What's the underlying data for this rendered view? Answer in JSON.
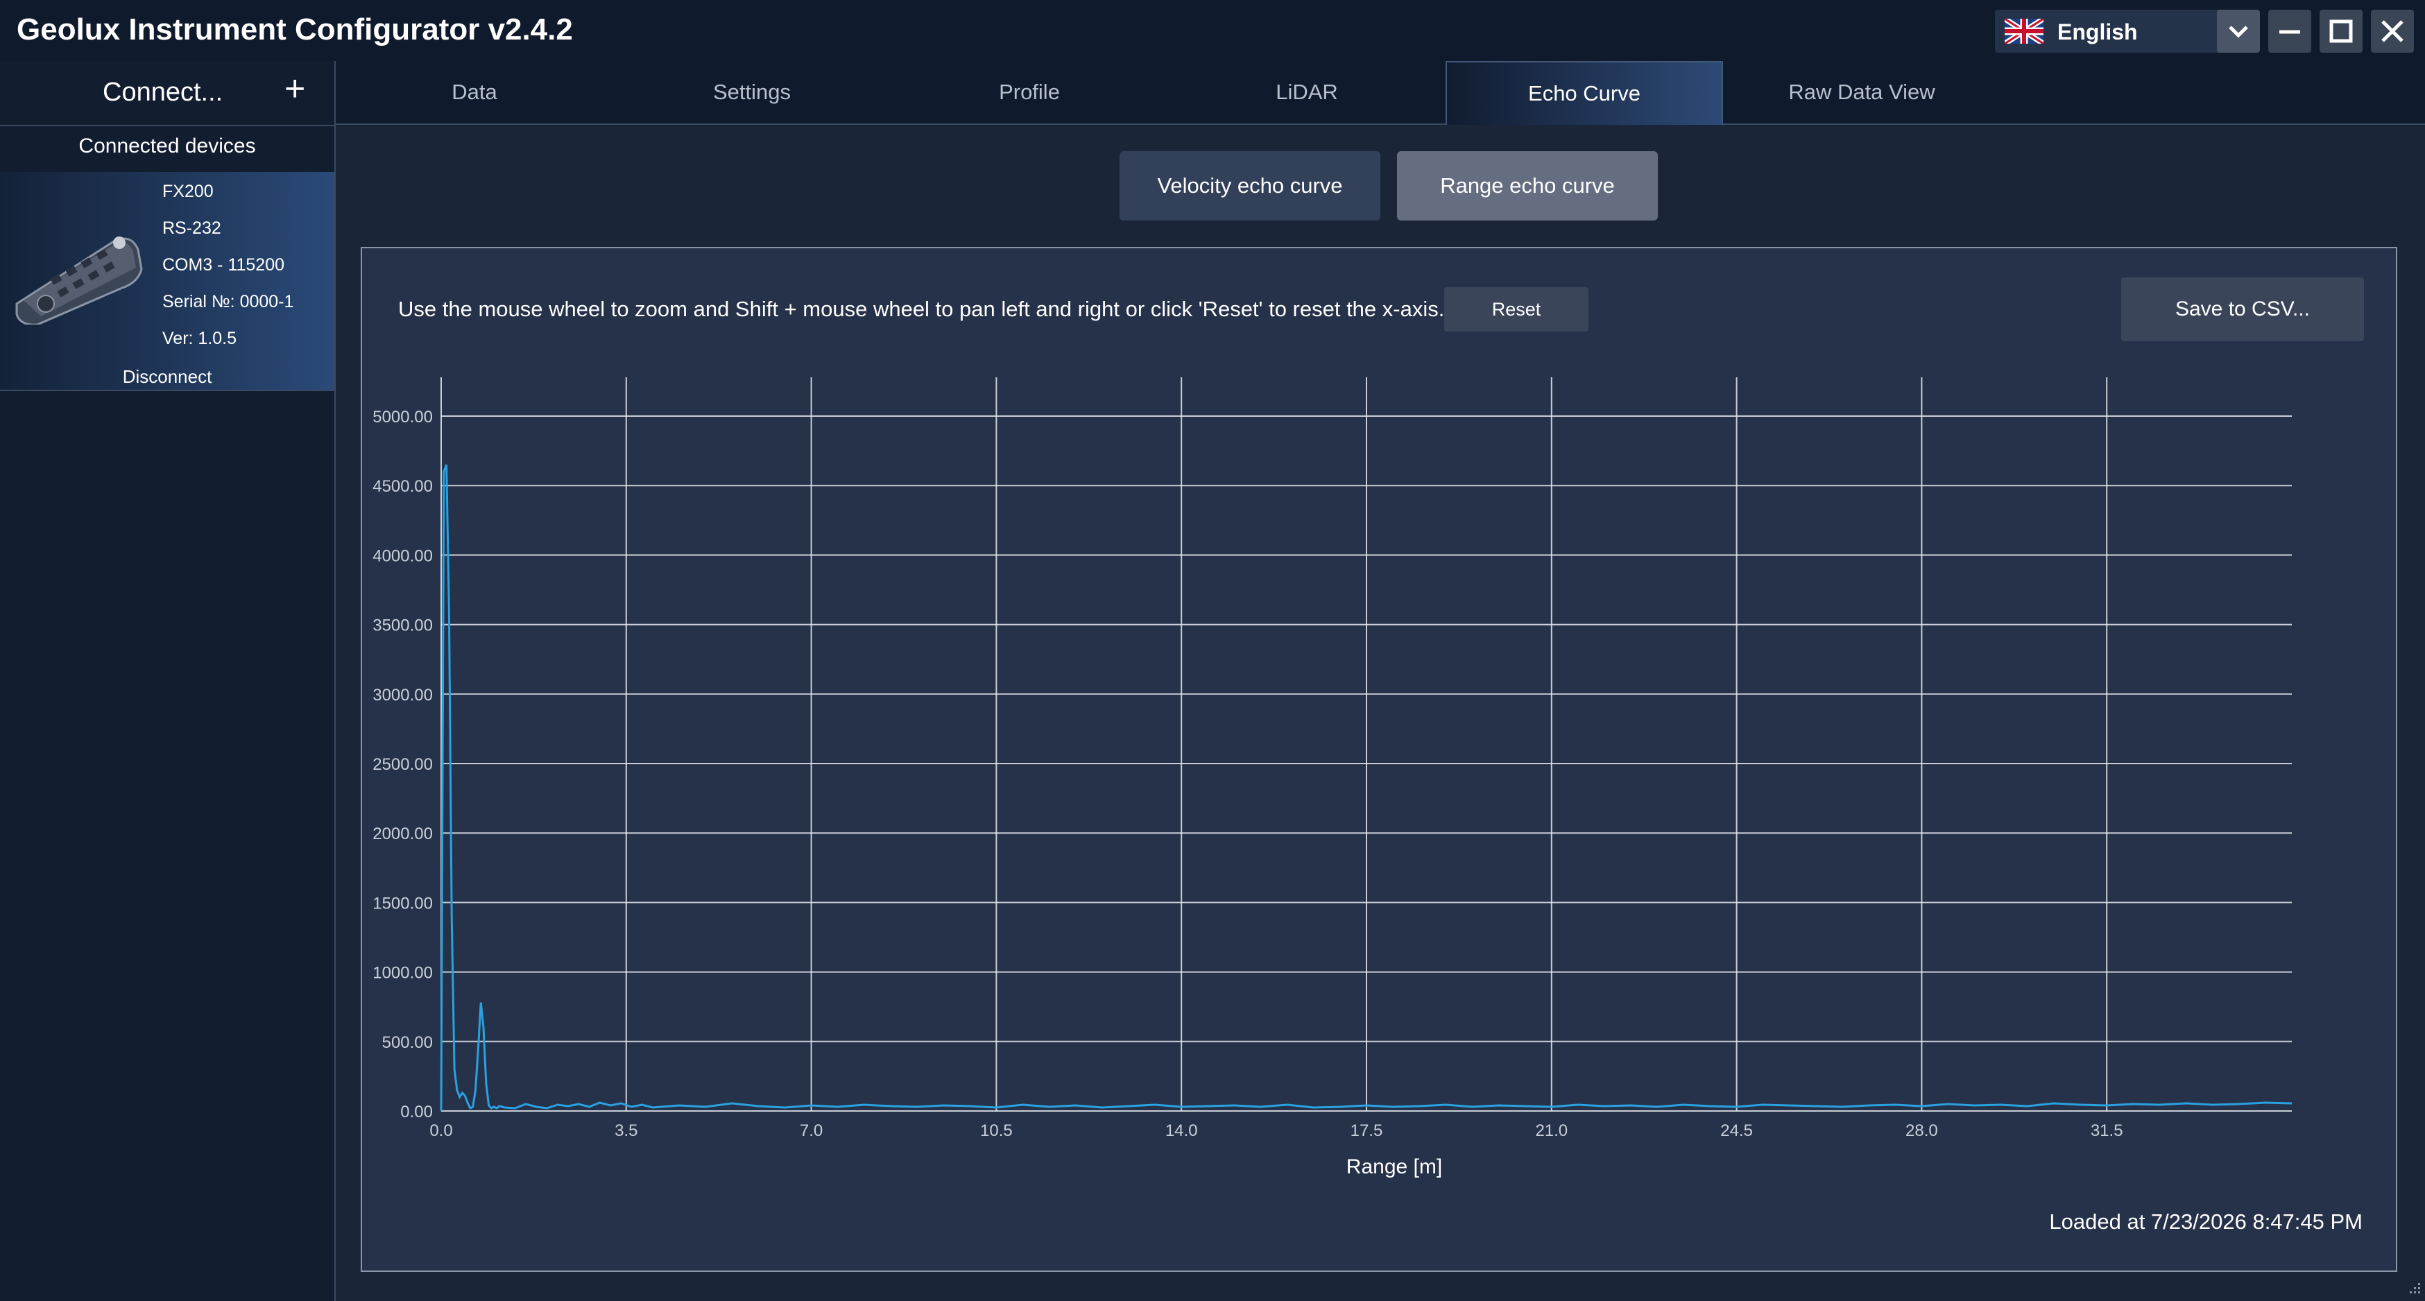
{
  "window": {
    "title": "Geolux Instrument Configurator v2.4.2",
    "language": "English",
    "controls": [
      "minimize",
      "maximize",
      "close"
    ]
  },
  "sidebar": {
    "connect_label": "Connect...",
    "add_icon": "plus-icon",
    "connected_header": "Connected devices",
    "device": {
      "model": "FX200",
      "interface": "RS-232",
      "port": "COM3 - 115200",
      "serial": "Serial №: 0000-1",
      "version": "Ver:  1.0.5",
      "disconnect_label": "Disconnect"
    }
  },
  "tabs": [
    {
      "label": "Data",
      "active": false
    },
    {
      "label": "Settings",
      "active": false
    },
    {
      "label": "Profile",
      "active": false
    },
    {
      "label": "LiDAR",
      "active": false
    },
    {
      "label": "Echo Curve",
      "active": true
    },
    {
      "label": "Raw Data View",
      "active": false
    }
  ],
  "echo": {
    "velocity_label": "Velocity echo curve",
    "range_label": "Range echo curve",
    "selected": "range",
    "hint": "Use the mouse wheel to zoom and Shift + mouse wheel to pan left and right or click 'Reset' to reset the x-axis.",
    "reset_label": "Reset",
    "save_label": "Save to CSV...",
    "loaded_text": "Loaded at 7/23/2026 8:47:45 PM"
  },
  "colors": {
    "line": "#2aa1e0",
    "grid": "#e6e9ef",
    "background": "#1b2538"
  },
  "chart_data": {
    "type": "line",
    "title": "",
    "xlabel": "Range [m]",
    "ylabel": "",
    "xlim": [
      0,
      35
    ],
    "ylim": [
      0,
      5000
    ],
    "grid": true,
    "x_ticks": [
      "0.0",
      "3.5",
      "7.0",
      "10.5",
      "14.0",
      "17.5",
      "21.0",
      "24.5",
      "28.0",
      "31.5"
    ],
    "y_ticks": [
      "0.00",
      "500.00",
      "1000.00",
      "1500.00",
      "2000.00",
      "2500.00",
      "3000.00",
      "3500.00",
      "4000.00",
      "4500.00",
      "5000.00"
    ],
    "series": [
      {
        "x": [
          0.0,
          0.05,
          0.1,
          0.15,
          0.2,
          0.25,
          0.3,
          0.35,
          0.4,
          0.45,
          0.5,
          0.55,
          0.6,
          0.65,
          0.7,
          0.75,
          0.8,
          0.85,
          0.9,
          0.95,
          1.0,
          1.05,
          1.1,
          1.2,
          1.4,
          1.6,
          1.8,
          2.0,
          2.2,
          2.4,
          2.6,
          2.8,
          3.0,
          3.2,
          3.4,
          3.6,
          3.8,
          4.0,
          4.5,
          5.0,
          5.5,
          6.0,
          6.5,
          7.0,
          7.5,
          8.0,
          8.5,
          9.0,
          9.5,
          10.0,
          10.5,
          11.0,
          11.5,
          12.0,
          12.5,
          13.0,
          13.5,
          14.0,
          14.5,
          15.0,
          15.5,
          16.0,
          16.5,
          17.0,
          17.5,
          18.0,
          18.5,
          19.0,
          19.5,
          20.0,
          20.5,
          21.0,
          21.5,
          22.0,
          22.5,
          23.0,
          23.5,
          24.0,
          24.5,
          25.0,
          25.5,
          26.0,
          26.5,
          27.0,
          27.5,
          28.0,
          28.5,
          29.0,
          29.5,
          30.0,
          30.5,
          31.0,
          31.5,
          32.0,
          32.5,
          33.0,
          33.5,
          34.0,
          34.5,
          35.0
        ],
        "y": [
          0,
          4600,
          4650,
          3600,
          1400,
          300,
          150,
          100,
          130,
          110,
          60,
          20,
          30,
          150,
          450,
          780,
          600,
          200,
          40,
          20,
          30,
          20,
          35,
          25,
          20,
          50,
          30,
          20,
          45,
          35,
          50,
          30,
          60,
          40,
          55,
          30,
          45,
          25,
          40,
          30,
          55,
          35,
          25,
          40,
          30,
          45,
          35,
          30,
          40,
          35,
          25,
          45,
          30,
          40,
          25,
          35,
          45,
          30,
          35,
          40,
          30,
          45,
          25,
          30,
          40,
          30,
          35,
          45,
          30,
          40,
          35,
          30,
          45,
          35,
          40,
          30,
          45,
          35,
          30,
          45,
          40,
          35,
          30,
          40,
          45,
          35,
          50,
          40,
          45,
          35,
          55,
          45,
          40,
          50,
          45,
          55,
          45,
          50,
          60,
          55
        ]
      }
    ]
  }
}
